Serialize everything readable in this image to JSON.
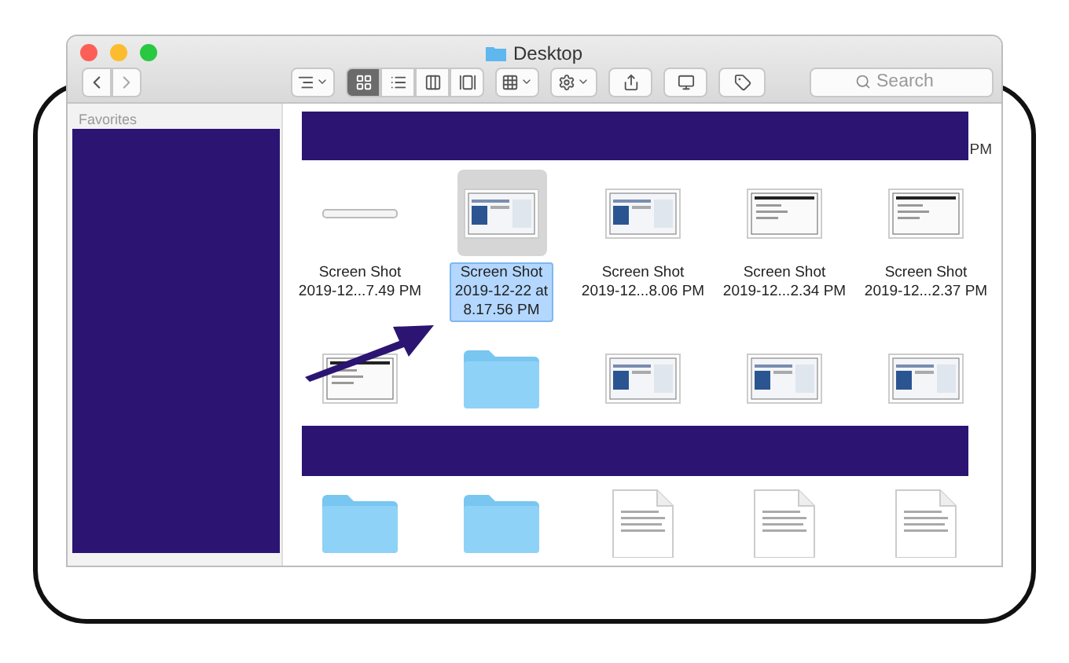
{
  "window": {
    "title": "Desktop"
  },
  "toolbar": {
    "view_modes": [
      {
        "kind": "icons",
        "selected": true
      },
      {
        "kind": "list",
        "selected": false
      },
      {
        "kind": "columns",
        "selected": false
      },
      {
        "kind": "gallery",
        "selected": false
      }
    ],
    "search": {
      "placeholder": "Search"
    }
  },
  "sidebar": {
    "heading": "Favorites"
  },
  "content": {
    "header_tail": "PM",
    "rows": [
      {
        "items": [
          {
            "kind": "bar-thumb",
            "selected": false,
            "label_lines": [
              "Screen Shot",
              "2019-12...7.49 PM"
            ]
          },
          {
            "kind": "screenshot",
            "selected": true,
            "label_lines": [
              "Screen Shot",
              "2019-12-22 at",
              "8.17.56 PM"
            ]
          },
          {
            "kind": "screenshot",
            "selected": false,
            "label_lines": [
              "Screen Shot",
              "2019-12...8.06 PM"
            ]
          },
          {
            "kind": "document-shot",
            "selected": false,
            "label_lines": [
              "Screen Shot",
              "2019-12...2.34 PM"
            ]
          },
          {
            "kind": "document-shot",
            "selected": false,
            "label_lines": [
              "Screen Shot",
              "2019-12...2.37 PM"
            ]
          }
        ]
      },
      {
        "items": [
          {
            "kind": "document-shot",
            "selected": false
          },
          {
            "kind": "folder",
            "selected": false
          },
          {
            "kind": "screenshot",
            "selected": false
          },
          {
            "kind": "screenshot",
            "selected": false
          },
          {
            "kind": "screenshot",
            "selected": false
          }
        ]
      },
      {
        "items": [
          {
            "kind": "folder",
            "selected": false
          },
          {
            "kind": "folder",
            "selected": false
          },
          {
            "kind": "document",
            "selected": false
          },
          {
            "kind": "document",
            "selected": false
          },
          {
            "kind": "document",
            "selected": false
          }
        ]
      }
    ]
  }
}
